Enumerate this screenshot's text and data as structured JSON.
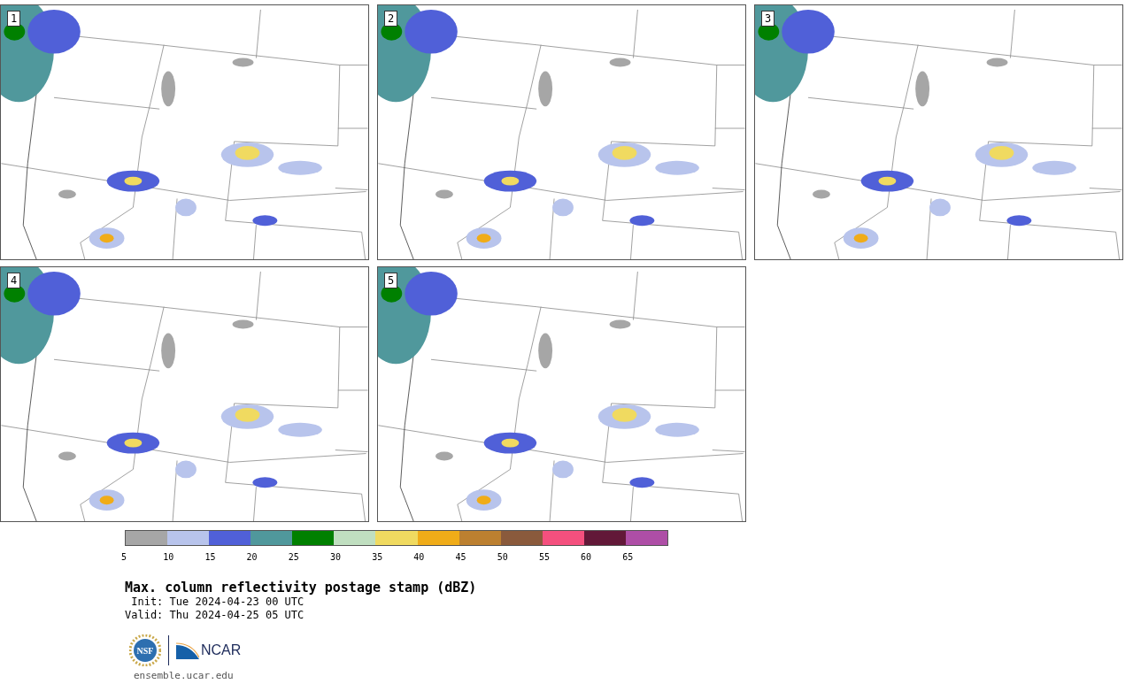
{
  "panels": [
    {
      "label": "1"
    },
    {
      "label": "2"
    },
    {
      "label": "3"
    },
    {
      "label": "4"
    },
    {
      "label": "5"
    }
  ],
  "colorbar": {
    "segments": [
      {
        "color": "#a6a6a6"
      },
      {
        "color": "#b8c4ec"
      },
      {
        "color": "#5060d8"
      },
      {
        "color": "#50989c"
      },
      {
        "color": "#008000"
      },
      {
        "color": "#c0dfc0"
      },
      {
        "color": "#f0da60"
      },
      {
        "color": "#f0ac18"
      },
      {
        "color": "#bc8030"
      },
      {
        "color": "#8a5a3c"
      },
      {
        "color": "#f4507e"
      },
      {
        "color": "#621838"
      },
      {
        "color": "#ae4ea6"
      }
    ],
    "ticks": [
      "5",
      "10",
      "15",
      "20",
      "25",
      "30",
      "35",
      "40",
      "45",
      "50",
      "55",
      "60",
      "65"
    ]
  },
  "title": "Max. column reflectivity postage stamp (dBZ)",
  "init": " Init: Tue 2024-04-23 00 UTC",
  "valid": "Valid: Thu 2024-04-25 05 UTC",
  "logos": {
    "nsf": "NSF",
    "ncar": "NCAR"
  },
  "url": "ensemble.ucar.edu"
}
